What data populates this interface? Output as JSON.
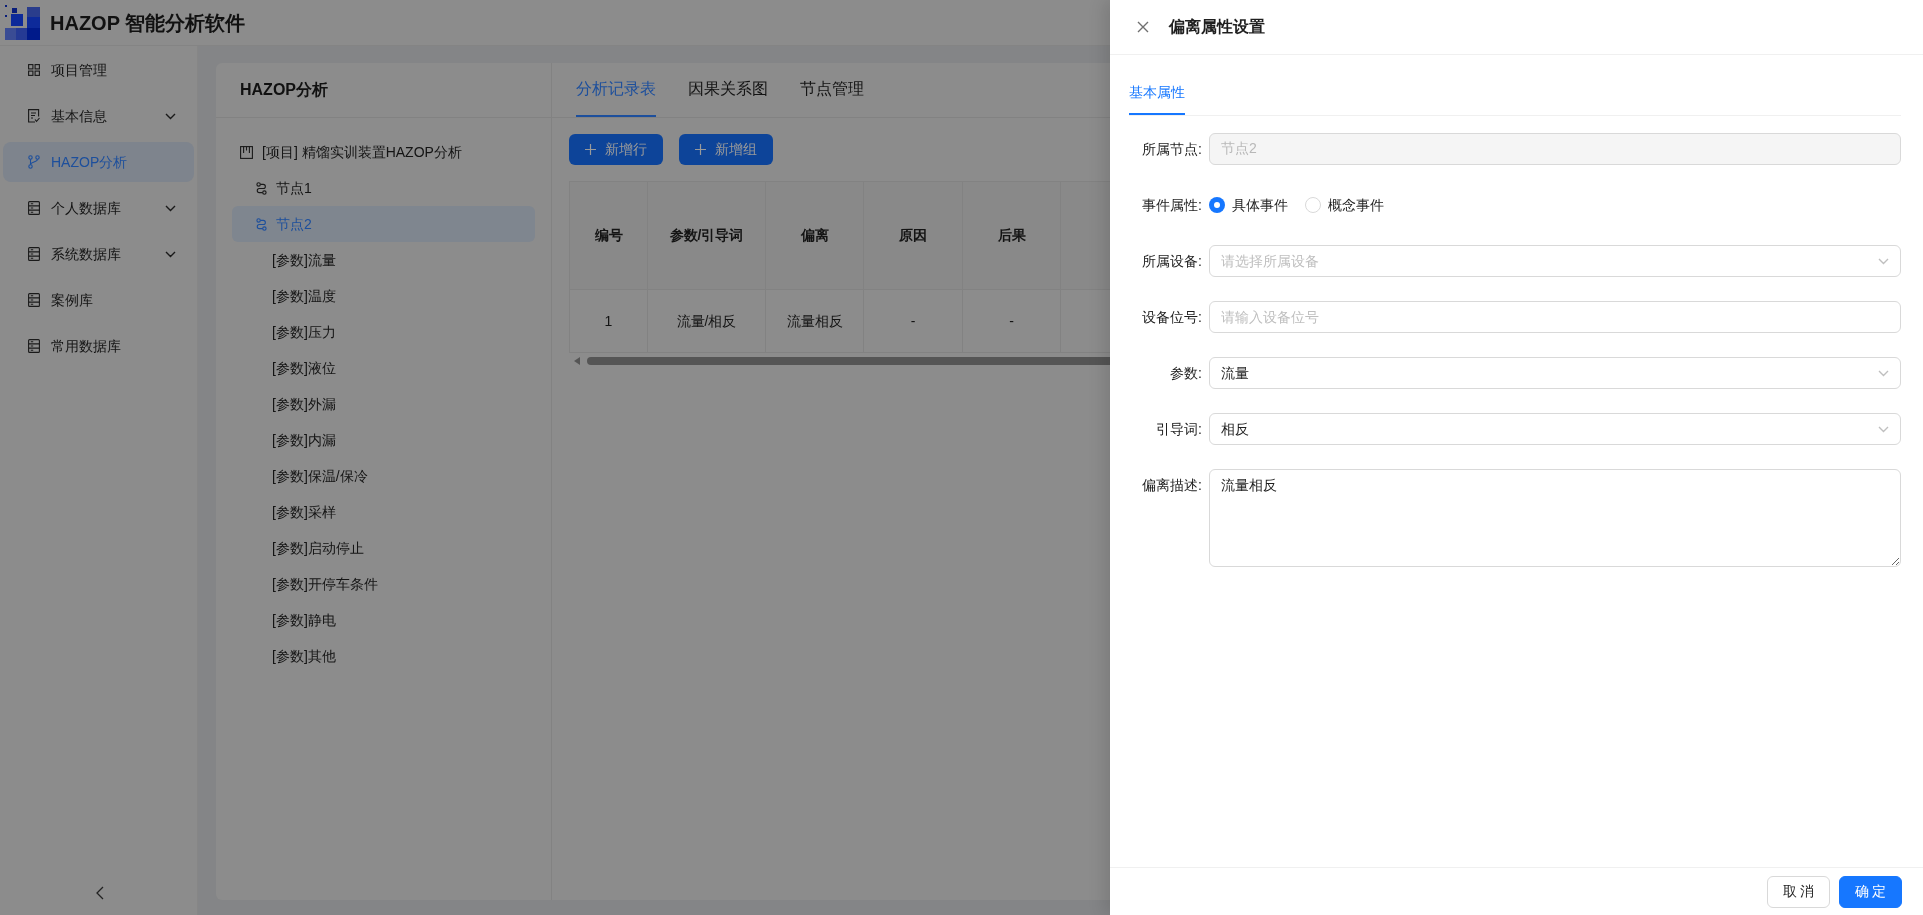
{
  "app": {
    "title": "HAZOP 智能分析软件"
  },
  "sidebar": {
    "items": [
      {
        "label": "项目管理",
        "kind": "item",
        "selected": false
      },
      {
        "label": "基本信息",
        "kind": "submenu",
        "expanded": false,
        "selected": false
      },
      {
        "label": "HAZOP分析",
        "kind": "item",
        "selected": true
      },
      {
        "label": "个人数据库",
        "kind": "submenu",
        "expanded": false,
        "selected": false
      },
      {
        "label": "系统数据库",
        "kind": "submenu",
        "expanded": false,
        "selected": false
      },
      {
        "label": "案例库",
        "kind": "item",
        "selected": false
      },
      {
        "label": "常用数据库",
        "kind": "item",
        "selected": false
      }
    ]
  },
  "tree_panel": {
    "title": "HAZOP分析",
    "tree": [
      {
        "label": "[项目] 精馏实训装置HAZOP分析",
        "kind": "project",
        "selected": false,
        "children": [
          {
            "label": "节点1",
            "kind": "node",
            "selected": false
          },
          {
            "label": "节点2",
            "kind": "node",
            "selected": true,
            "children": [
              {
                "label": "[参数]流量",
                "kind": "parameter",
                "selected": false
              },
              {
                "label": "[参数]温度",
                "kind": "parameter",
                "selected": false
              },
              {
                "label": "[参数]压力",
                "kind": "parameter",
                "selected": false
              },
              {
                "label": "[参数]液位",
                "kind": "parameter",
                "selected": false
              },
              {
                "label": "[参数]外漏",
                "kind": "parameter",
                "selected": false
              },
              {
                "label": "[参数]内漏",
                "kind": "parameter",
                "selected": false
              },
              {
                "label": "[参数]保温/保冷",
                "kind": "parameter",
                "selected": false
              },
              {
                "label": "[参数]采样",
                "kind": "parameter",
                "selected": false
              },
              {
                "label": "[参数]启动停止",
                "kind": "parameter",
                "selected": false
              },
              {
                "label": "[参数]开停车条件",
                "kind": "parameter",
                "selected": false
              },
              {
                "label": "[参数]静电",
                "kind": "parameter",
                "selected": false
              },
              {
                "label": "[参数]其他",
                "kind": "parameter",
                "selected": false
              }
            ]
          }
        ]
      }
    ]
  },
  "workspace": {
    "tabs": [
      {
        "label": "分析记录表",
        "selected": true
      },
      {
        "label": "因果关系图",
        "selected": false
      },
      {
        "label": "节点管理",
        "selected": false
      }
    ],
    "toolbar": [
      {
        "label": "新增行"
      },
      {
        "label": "新增组"
      }
    ],
    "table": {
      "columns": [
        "编号",
        "参数/引导词",
        "偏离",
        "原因",
        "后果"
      ],
      "rows": [
        [
          "1",
          "流量/相反",
          "流量相反",
          "-",
          "-"
        ]
      ]
    }
  },
  "drawer": {
    "title": "偏离属性设置",
    "tabs": [
      {
        "label": "基本属性",
        "selected": true
      }
    ],
    "fields": [
      {
        "kind": "input",
        "label": "所属节点:",
        "value": "节点2",
        "disabled": true
      },
      {
        "kind": "radio",
        "label": "事件属性:",
        "options": [
          {
            "label": "具体事件",
            "selected": true
          },
          {
            "label": "概念事件",
            "selected": false
          }
        ]
      },
      {
        "kind": "select",
        "label": "所属设备:",
        "placeholder": "请选择所属设备"
      },
      {
        "kind": "input",
        "label": "设备位号:",
        "placeholder": "请输入设备位号"
      },
      {
        "kind": "select",
        "label": "参数:",
        "value": "流量"
      },
      {
        "kind": "select",
        "label": "引导词:",
        "value": "相反"
      },
      {
        "kind": "textarea",
        "label": "偏离描述:",
        "value": "流量相反"
      }
    ],
    "buttons": [
      {
        "label": "取 消",
        "kind": "default"
      },
      {
        "label": "确 定",
        "kind": "primary"
      }
    ]
  }
}
